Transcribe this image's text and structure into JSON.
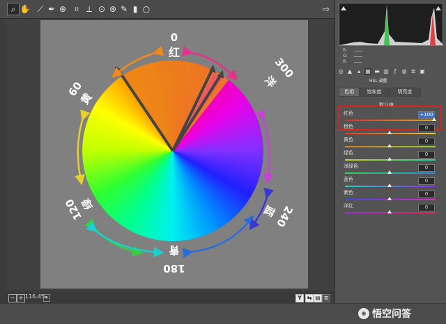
{
  "toolbar": {
    "icons": [
      "zoom-icon",
      "hand-icon",
      "white-balance-icon",
      "color-sampler-icon",
      "target-adjust-icon",
      "crop-icon",
      "straighten-icon",
      "spot-removal-icon",
      "red-eye-icon",
      "brush-icon",
      "graduated-filter-icon",
      "radial-filter-icon"
    ],
    "glyphs": [
      "⌕",
      "✋",
      "⟋",
      "✒",
      "⊕",
      "⌗",
      "⟂",
      "⊙",
      "⊛",
      "✎",
      "▮",
      "○"
    ],
    "export_glyph": "⇨"
  },
  "wheel": {
    "labels": {
      "top": "红",
      "right_top": "洋",
      "right_bottom": "蓝",
      "bottom": "青",
      "left_bottom": "绿",
      "left_top": "黄"
    },
    "degrees": {
      "top": "0",
      "right_top": "300",
      "right_bottom": "240",
      "bottom": "180",
      "left_bottom": "120",
      "left_top": "60"
    },
    "colors": {
      "arrow_top_left": "#f08a18",
      "arrow_top_right": "#e6328c",
      "arrow_left_top": "#e8d02a",
      "arrow_left_bottom": "#38d040",
      "arrow_bottom_left": "#18d2d0",
      "arrow_bottom_right": "#2a6cdc",
      "arrow_right_top": "#c840d8",
      "arrow_right_bottom": "#3838d8"
    }
  },
  "status": {
    "zoom": "116.4%",
    "minus": "−",
    "plus": "+",
    "y_label": "Y",
    "dropdown_glyph": "▾"
  },
  "panel": {
    "rgb": {
      "r": "R:",
      "g": "G:",
      "b": "B:"
    },
    "title": "HSL 调整",
    "subtabs": [
      "色相",
      "饱和度",
      "明亮度"
    ],
    "default_label": "默认值",
    "sliders": [
      {
        "label": "红色",
        "value": "+100",
        "position": 1.0,
        "track": [
          "#e02a2a",
          "#e0a82a"
        ]
      },
      {
        "label": "橙色",
        "value": "0",
        "position": 0.5,
        "track": [
          "#e03a2a",
          "#e0d02a"
        ]
      },
      {
        "label": "黄色",
        "value": "0",
        "position": 0.5,
        "track": [
          "#e07a2a",
          "#8ad02a"
        ]
      },
      {
        "label": "绿色",
        "value": "0",
        "position": 0.5,
        "track": [
          "#c8d02a",
          "#2ad0a0"
        ]
      },
      {
        "label": "浅绿色",
        "value": "0",
        "position": 0.5,
        "track": [
          "#3ad050",
          "#2a8ae0"
        ]
      },
      {
        "label": "蓝色",
        "value": "0",
        "position": 0.5,
        "track": [
          "#2ad0d0",
          "#8a2ae0"
        ]
      },
      {
        "label": "紫色",
        "value": "0",
        "position": 0.5,
        "track": [
          "#3a4ae0",
          "#e02ac0"
        ]
      },
      {
        "label": "洋红",
        "value": "0",
        "position": 0.5,
        "track": [
          "#a02ae0",
          "#e02a4a"
        ]
      }
    ]
  },
  "watermark": {
    "text": "悟空问答",
    "icon_text": "◉"
  }
}
